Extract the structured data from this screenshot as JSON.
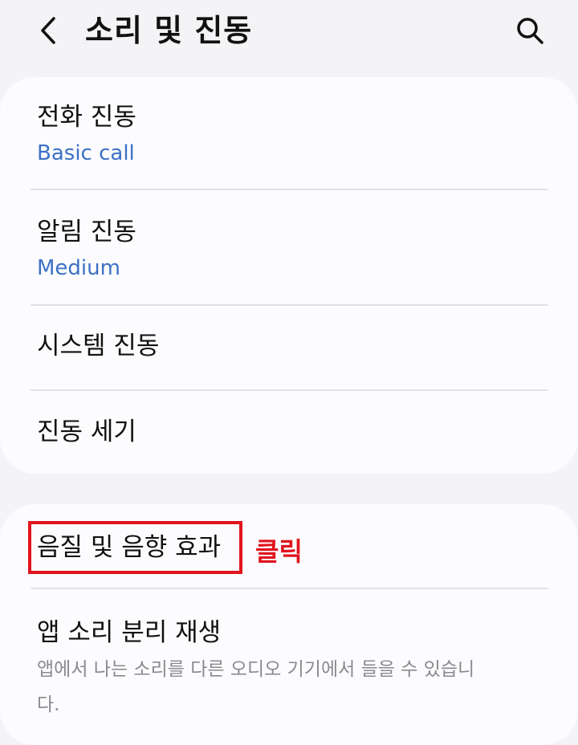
{
  "header": {
    "title": "소리 및 진동",
    "back_icon": "chevron-left-icon",
    "search_icon": "search-icon"
  },
  "vibration_card": {
    "items": [
      {
        "title": "전화 진동",
        "subtitle": "Basic call"
      },
      {
        "title": "알림 진동",
        "subtitle": "Medium"
      },
      {
        "title": "시스템 진동"
      },
      {
        "title": "진동 세기"
      }
    ]
  },
  "sound_card": {
    "items": [
      {
        "title": "음질 및 음향 효과"
      },
      {
        "title": "앱 소리 분리 재생",
        "description": "앱에서 나는 소리를 다른 오디오 기기에서 들을 수 있습니다."
      }
    ]
  },
  "annotation": {
    "label": "클릭",
    "color": "#e0141e"
  },
  "colors": {
    "background": "#f4f4f6",
    "card": "#fcfcfe",
    "subtitle_blue": "#3d70c6",
    "description_gray": "#8a8a8e"
  }
}
